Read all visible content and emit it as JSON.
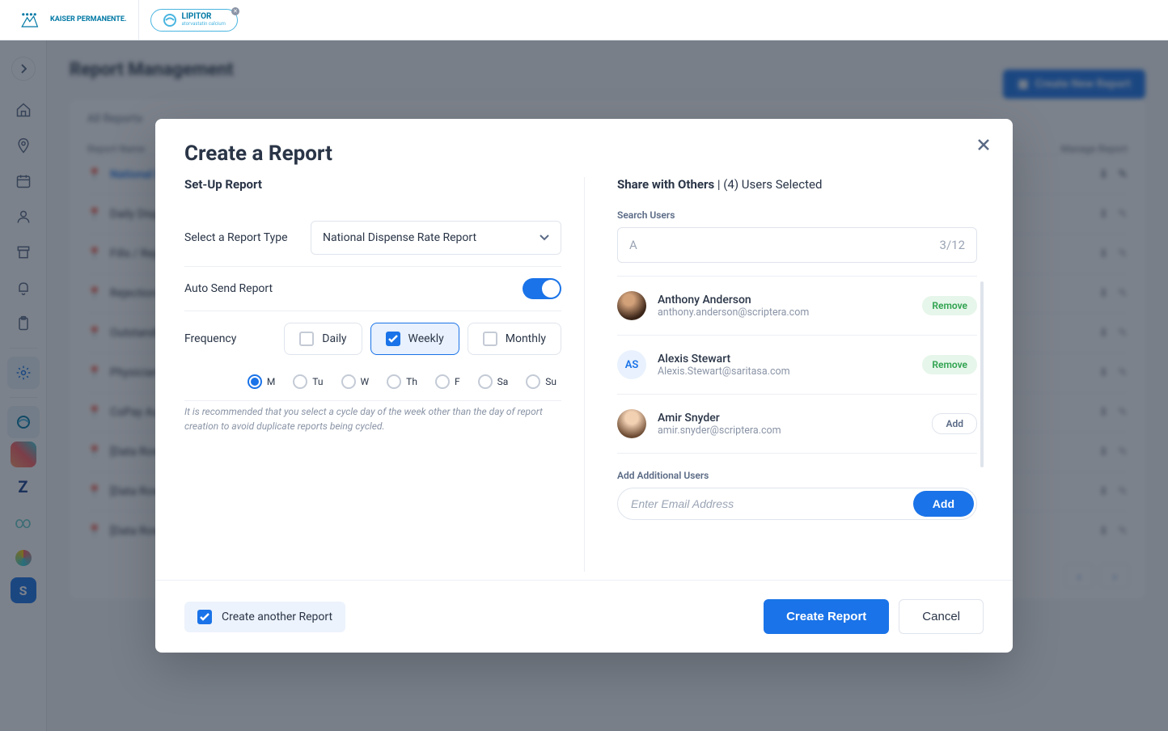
{
  "header": {
    "org_name": "KAISER PERMANENTE.",
    "drug_tab": "LIPITOR"
  },
  "page": {
    "title": "Report Management",
    "create_btn": "Create New Report",
    "tabs_label": "All Reports",
    "col_name": "Report Name",
    "col_manage": "Manage Report",
    "rows": [
      "National Dispense Rate Report",
      "Daily Dispenses",
      "Fills / Rejections",
      "Rejections",
      "Outstanding Claims",
      "Physician Activity",
      "CoPay Authorization Totals",
      "[Data Row]",
      "[Data Row]",
      "[Data Row]"
    ]
  },
  "modal": {
    "title": "Create a Report",
    "left": {
      "heading": "Set-Up Report",
      "type_label": "Select a Report Type",
      "type_value": "National Dispense Rate Report",
      "auto_label": "Auto Send Report",
      "freq_label": "Frequency",
      "freq": {
        "daily": "Daily",
        "weekly": "Weekly",
        "monthly": "Monthly"
      },
      "days": {
        "m": "M",
        "tu": "Tu",
        "w": "W",
        "th": "Th",
        "f": "F",
        "sa": "Sa",
        "su": "Su"
      },
      "help": "It is recommended that you select a cycle day of the week other than the day of report creation to avoid duplicate reports being cycled."
    },
    "right": {
      "heading_a": "Share with Others",
      "heading_b": "(4) Users Selected",
      "search_label": "Search Users",
      "search_value": "A",
      "search_count": "3/12",
      "users": [
        {
          "name": "Anthony Anderson",
          "email": "anthony.anderson@scriptera.com",
          "action": "Remove"
        },
        {
          "name": "Alexis Stewart",
          "email": "Alexis.Stewart@saritasa.com",
          "action": "Remove",
          "initials": "AS"
        },
        {
          "name": "Amir Snyder",
          "email": "amir.snyder@scriptera.com",
          "action": "Add"
        }
      ],
      "add_label": "Add Additional Users",
      "email_placeholder": "Enter Email Address",
      "add_btn": "Add"
    },
    "footer": {
      "another": "Create another Report",
      "submit": "Create Report",
      "cancel": "Cancel"
    }
  }
}
